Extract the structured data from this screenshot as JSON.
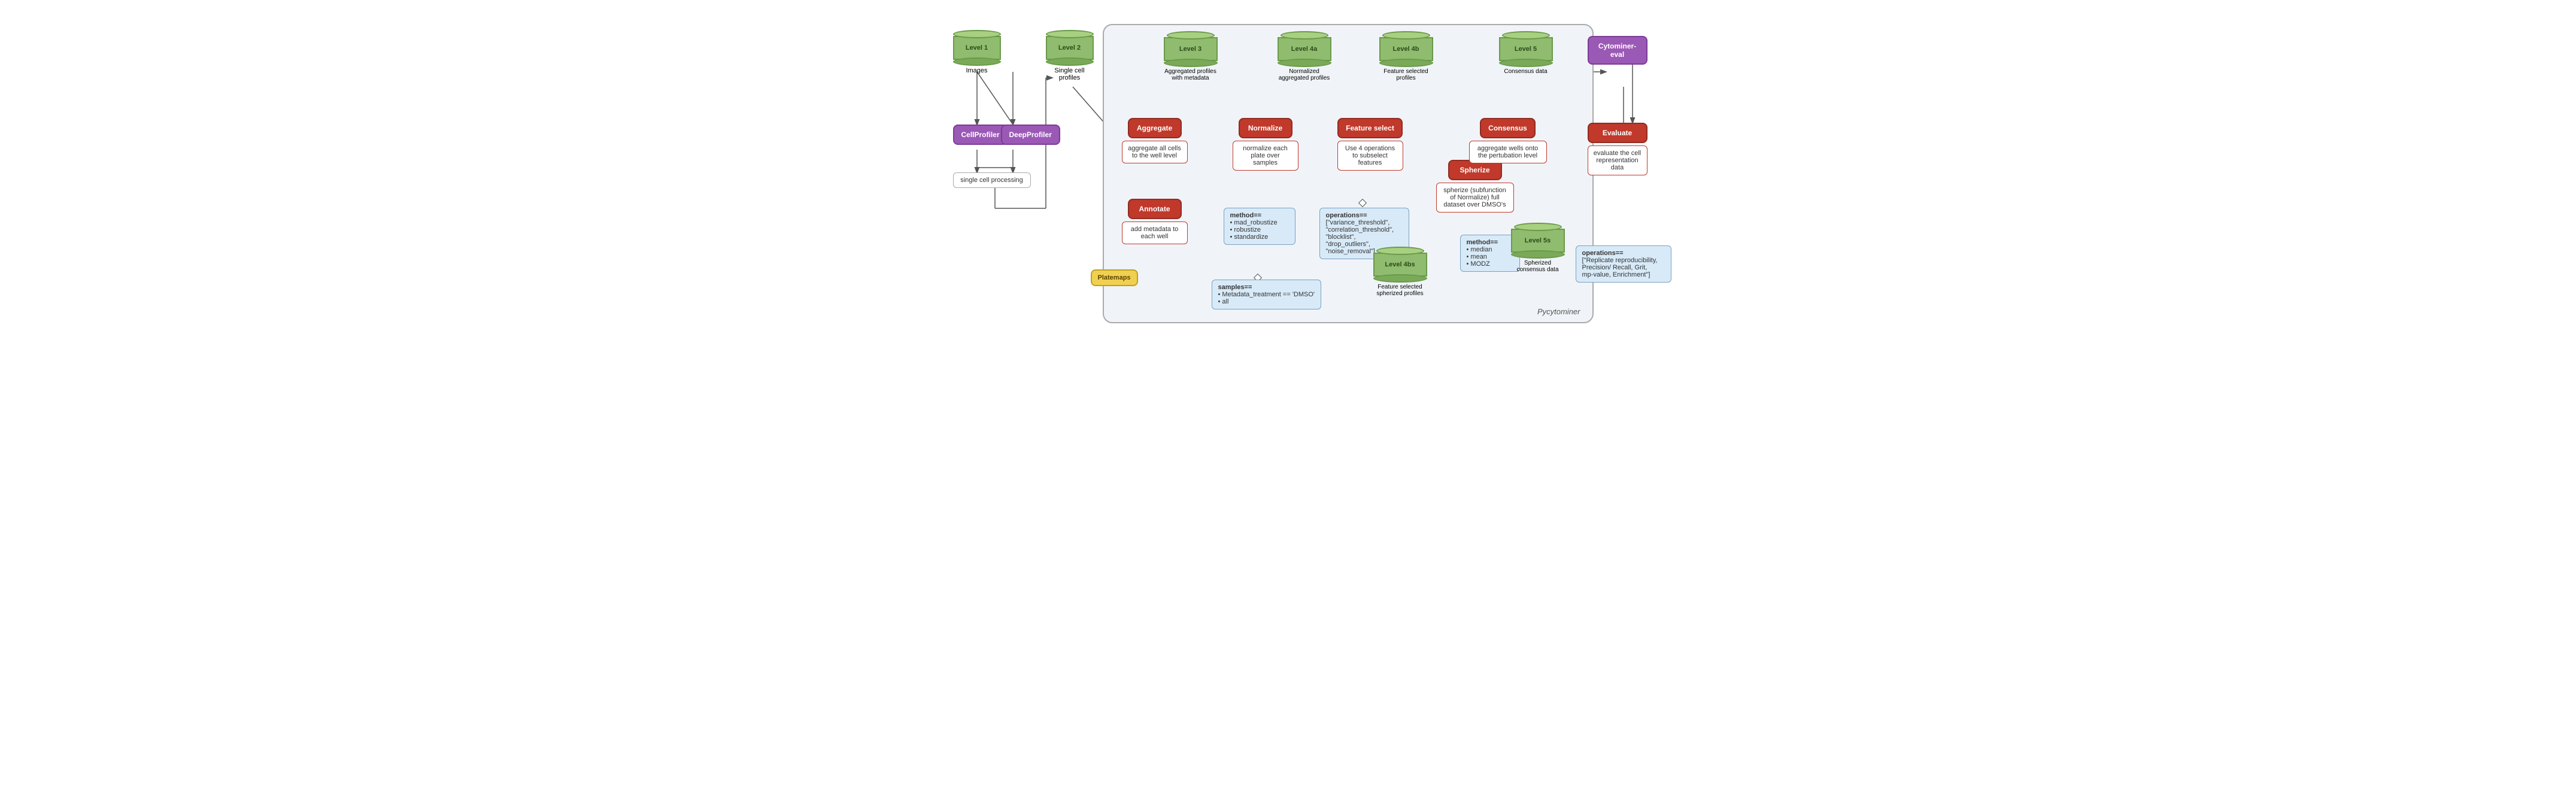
{
  "diagram": {
    "title": "Pycytominer",
    "levels": {
      "level1": {
        "label": "Level 1",
        "sublabel": "Images"
      },
      "level2": {
        "label": "Level 2",
        "sublabel": "Single cell profiles"
      },
      "level3": {
        "label": "Level 3",
        "sublabel": "Aggregated profiles with metadata"
      },
      "level4a": {
        "label": "Level 4a",
        "sublabel": "Normalized aggregated profiles"
      },
      "level4b": {
        "label": "Level 4b",
        "sublabel": "Feature selected profiles"
      },
      "level4bs": {
        "label": "Level 4bs",
        "sublabel": "Feature selected spherized profiles"
      },
      "level5": {
        "label": "Level 5",
        "sublabel": "Consensus data"
      },
      "level5s": {
        "label": "Level 5s",
        "sublabel": "Spherized consensus data"
      }
    },
    "tools": {
      "cellprofiler": "CellProfiler",
      "deepprofiler": "DeepProfiler",
      "singlecell": "single cell processing",
      "cytominer_eval": "Cytominer-eval",
      "platemaps": "Platemaps"
    },
    "processes": {
      "aggregate": {
        "label": "Aggregate",
        "desc": "aggregate all cells to the well level"
      },
      "annotate": {
        "label": "Annotate",
        "desc": "add metadata to each well"
      },
      "normalize": {
        "label": "Normalize",
        "desc": "normalize each plate over samples"
      },
      "feature_select": {
        "label": "Feature select",
        "desc": "Use 4 operations to subselect features"
      },
      "spherize": {
        "label": "Spherize",
        "desc": "spherize (subfunction of Normalize) full dataset over DMSO's"
      },
      "consensus": {
        "label": "Consensus",
        "desc": "aggregate wells onto the pertubation level"
      },
      "evaluate": {
        "label": "Evaluate",
        "desc": "evaluate the cell representation data"
      }
    },
    "info_boxes": {
      "normalize_method": {
        "title": "method==",
        "items": [
          "mad_robustize",
          "robustize",
          "standardize"
        ]
      },
      "normalize_samples": {
        "title": "samples==",
        "items": [
          "Metadata_treatment == 'DMSO'",
          "all"
        ]
      },
      "feature_operations": {
        "title": "operations==",
        "items": [
          "[\"variance_threshold\",",
          "\"correlation_threshold\",",
          "\"blocklist\",",
          "\"drop_outliers\",",
          "\"noise_removal\"]"
        ]
      },
      "consensus_method": {
        "title": "method==",
        "items": [
          "median",
          "mean",
          "MODZ"
        ]
      },
      "evaluate_operations": {
        "title": "operations==",
        "items": [
          "[\"Replicate reproducibility,",
          "Precision/ Recall, Grit,",
          "mp-value, Enrichment\"]"
        ]
      }
    }
  }
}
